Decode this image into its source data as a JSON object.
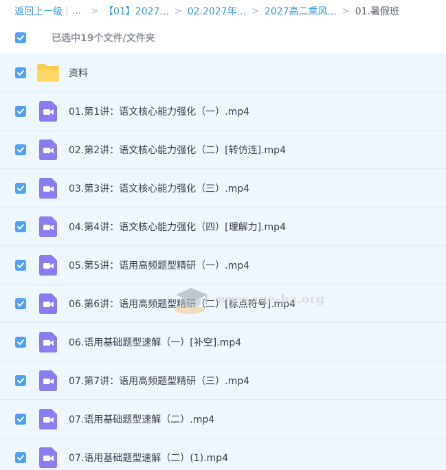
{
  "breadcrumb": {
    "back": "返回上一级",
    "bar": "|",
    "ellipsis": "...",
    "items": [
      "【01】2027...",
      "02.2027年...",
      "2027高二乘风..."
    ],
    "current": "01.暑假班",
    "arrow": ">"
  },
  "selection": {
    "count_text": "已选中19个文件/文件夹"
  },
  "files": [
    {
      "name": "资料",
      "type": "folder",
      "checked": true
    },
    {
      "name": "01.第1讲：语文核心能力强化（一）.mp4",
      "type": "video",
      "checked": true
    },
    {
      "name": "02.第2讲：语文核心能力强化（二）[转仿连].mp4",
      "type": "video",
      "checked": true
    },
    {
      "name": "03.第3讲：语文核心能力强化（三）.mp4",
      "type": "video",
      "checked": true
    },
    {
      "name": "04.第4讲：语文核心能力强化（四）[理解力].mp4",
      "type": "video",
      "checked": true
    },
    {
      "name": "05.第5讲：语用高频题型精研（一）.mp4",
      "type": "video",
      "checked": true
    },
    {
      "name": "06.第6讲：语用高频题型精研（二）[标点符号].mp4",
      "type": "video",
      "checked": true
    },
    {
      "name": "06.语用基础题型速解（一）[补空].mp4",
      "type": "video",
      "checked": true
    },
    {
      "name": "07.第7讲：语用高频题型精研（三）.mp4",
      "type": "video",
      "checked": true
    },
    {
      "name": "07.语用基础题型速解（二）.mp4",
      "type": "video",
      "checked": true
    },
    {
      "name": "07.语用基础题型速解（二）(1).mp4",
      "type": "video",
      "checked": true
    }
  ],
  "watermark": {
    "text": "www.xue-ba.org"
  },
  "colors": {
    "link": "#2f93e8",
    "checkbox": "#4ea1f3",
    "row_bg": "#eef6fe",
    "video_icon": "#8a7df2",
    "folder_icon": "#ffc94d"
  }
}
